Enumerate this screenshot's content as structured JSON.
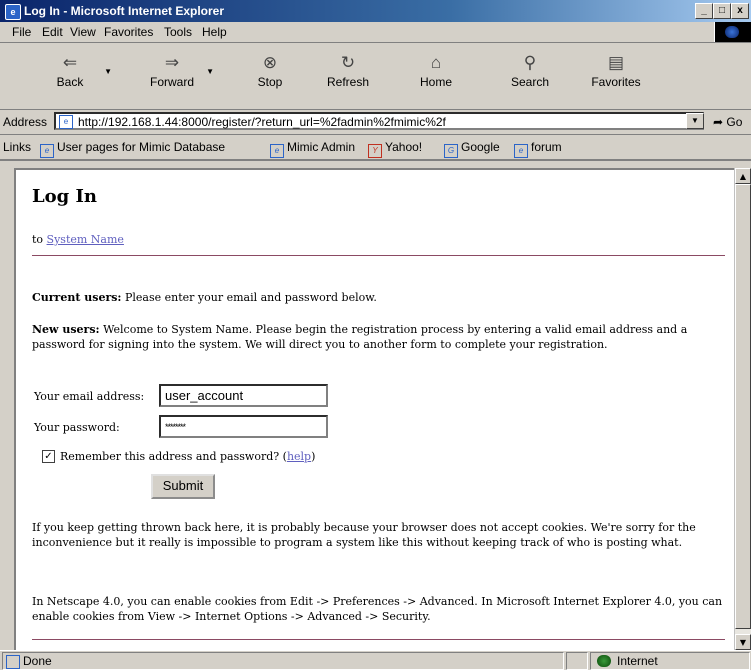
{
  "window": {
    "title": "Log In - Microsoft Internet Explorer",
    "controls": [
      "_",
      "□",
      "x"
    ]
  },
  "menu": [
    "File",
    "Edit",
    "View",
    "Favorites",
    "Tools",
    "Help"
  ],
  "toolbar": {
    "back": "Back",
    "forward": "Forward",
    "stop": "Stop",
    "refresh": "Refresh",
    "home": "Home",
    "search": "Search",
    "favorites": "Favorites"
  },
  "address": {
    "label": "Address",
    "url": "http://192.168.1.44:8000/register/?return_url=%2fadmin%2fmimic%2f",
    "go": "Go"
  },
  "links": {
    "label": "Links",
    "items": [
      "User pages for Mimic Database",
      "Mimic Admin",
      "Yahoo!",
      "Google",
      "forum"
    ]
  },
  "page": {
    "title": "Log In",
    "subtitle_prefix": "to",
    "system_name_link": "System Name",
    "current_users_label": "Current users:",
    "current_users_text": "Please enter your email and password below.",
    "new_users_label": "New users:",
    "new_users_text": "Welcome to System Name. Please begin the registration process by entering a valid email address and a password for signing into the system. We will direct you to another form to complete your registration.",
    "email_label": "Your email address:",
    "email_value": "user_account",
    "password_label": "Your password:",
    "password_value": "********",
    "remember_label": "Remember this address and password?",
    "help_link": "help",
    "submit": "Submit",
    "cookie_text": "If you keep getting thrown back here, it is probably because your browser does not accept cookies. We're sorry for the inconvenience but it really is impossible to program a system like this without keeping track of who is posting what.",
    "netscape_text": "In Netscape 4.0, you can enable cookies from Edit -> Preferences -> Advanced. In Microsoft Internet Explorer 4.0, you can enable cookies from View -> Internet Options -> Advanced -> Security."
  },
  "status": {
    "left": "Done",
    "zone": "Internet"
  }
}
